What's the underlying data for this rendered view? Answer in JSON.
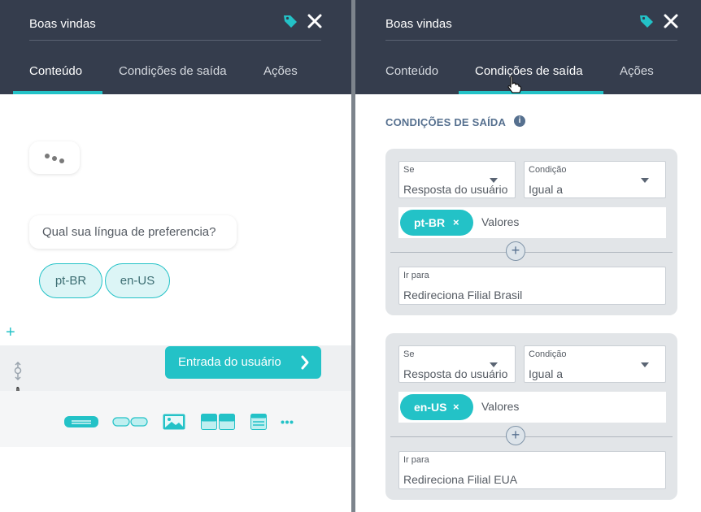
{
  "left_panel": {
    "title": "Boas vindas",
    "tabs": [
      {
        "label": "Conteúdo"
      },
      {
        "label": "Condições de saída"
      },
      {
        "label": "Ações"
      }
    ],
    "active_tab": "Conteúdo",
    "typing_indicator": "...",
    "message": "Qual sua língua de preferencia?",
    "options": [
      "pt-BR",
      "en-US"
    ],
    "add_symbol": "+",
    "user_input_button": "Entrada do usuário",
    "toolbar_icons": [
      "text-block-icon",
      "quick-replies-icon",
      "image-icon",
      "carousel-icon",
      "list-icon",
      "more-icon"
    ]
  },
  "right_panel": {
    "title": "Boas vindas",
    "tabs": [
      {
        "label": "Conteúdo"
      },
      {
        "label": "Condições de saída"
      },
      {
        "label": "Ações"
      }
    ],
    "active_tab": "Condições de saída",
    "section_title": "CONDIÇÕES DE SAÍDA",
    "info_symbol": "i",
    "conditions": [
      {
        "if_label": "Se",
        "if_value": "Resposta do usuário",
        "condition_label": "Condição",
        "condition_value": "Igual a",
        "chip": "pt-BR",
        "chip_remove": "×",
        "values_placeholder": "Valores",
        "add_symbol": "+",
        "goto_label": "Ir para",
        "goto_value": "Redireciona Filial Brasil"
      },
      {
        "if_label": "Se",
        "if_value": "Resposta do usuário",
        "condition_label": "Condição",
        "condition_value": "Igual a",
        "chip": "en-US",
        "chip_remove": "×",
        "values_placeholder": "Valores",
        "add_symbol": "+",
        "goto_label": "Ir para",
        "goto_value": "Redireciona Filial EUA"
      }
    ]
  },
  "colors": {
    "header_bg": "#353d4d",
    "accent": "#23c2c7",
    "section_title": "#56708f"
  }
}
